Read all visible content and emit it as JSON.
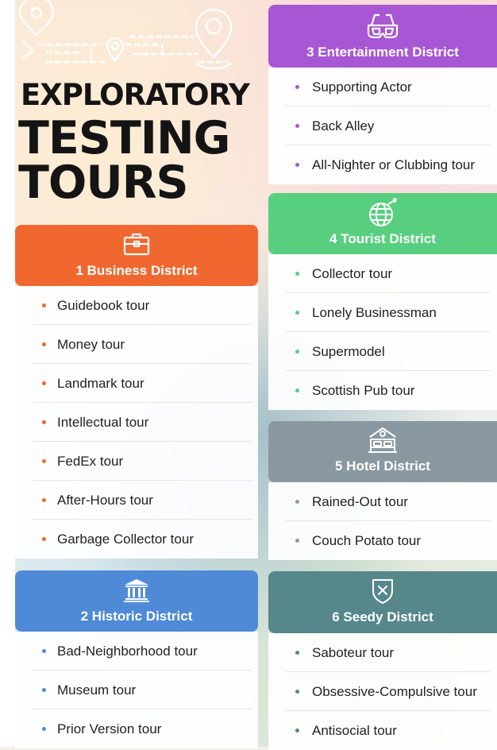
{
  "title": {
    "line1": "EXPLORATORY",
    "line2": "TESTING",
    "line3": "TOURS"
  },
  "colors": {
    "business": "#f0682f",
    "historic": "#4f8ad6",
    "entertainment": "#a756d4",
    "tourist": "#58cf7f",
    "hotel": "#8a99a1",
    "seedy": "#56878b"
  },
  "districts": {
    "business": {
      "title": "1 Business District",
      "icon": "briefcase-icon",
      "tours": [
        "Guidebook tour",
        "Money tour",
        "Landmark tour",
        "Intellectual tour",
        "FedEx tour",
        "After-Hours tour",
        "Garbage Collector tour"
      ]
    },
    "historic": {
      "title": "2 Historic District",
      "icon": "museum-icon",
      "tours": [
        "Bad-Neighborhood tour",
        "Museum tour",
        "Prior Version tour"
      ]
    },
    "entertainment": {
      "title": "3 Entertainment District",
      "icon": "3d-glasses-icon",
      "tours": [
        "Supporting Actor",
        "Back Alley",
        "All-Nighter or Clubbing tour"
      ]
    },
    "tourist": {
      "title": "4 Tourist District",
      "icon": "globe-plane-icon",
      "tours": [
        "Collector tour",
        "Lonely Businessman",
        "Supermodel",
        "Scottish Pub tour"
      ]
    },
    "hotel": {
      "title": "5 Hotel District",
      "icon": "hotel-bed-icon",
      "tours": [
        "Rained-Out tour",
        "Couch Potato tour"
      ]
    },
    "seedy": {
      "title": "6 Seedy District",
      "icon": "shield-x-icon",
      "tours": [
        "Saboteur tour",
        "Obsessive-Compulsive tour",
        "Antisocial tour"
      ]
    }
  }
}
